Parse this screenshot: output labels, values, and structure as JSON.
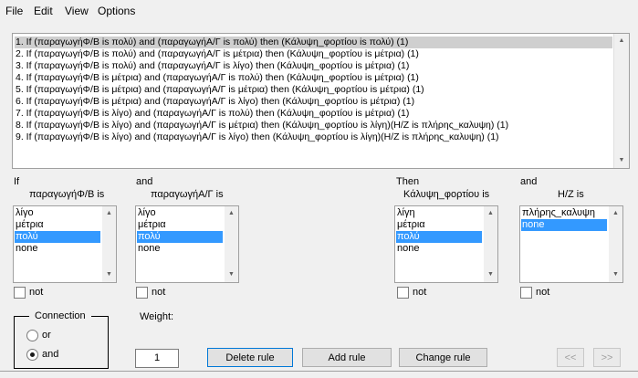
{
  "menu": [
    "File",
    "Edit",
    "View",
    "Options"
  ],
  "rules": [
    "1. If (παραγωγήΦ/Β is πολύ) and (παραγωγήΑ/Γ is πολύ) then (Κάλυψη_φορτίου is πολύ) (1)",
    "2. If (παραγωγήΦ/Β is πολύ) and (παραγωγήΑ/Γ is μέτρια) then (Κάλυψη_φορτίου is μέτρια) (1)",
    "3. If (παραγωγήΦ/Β is πολύ) and (παραγωγήΑ/Γ is λίγο) then (Κάλυψη_φορτίου is μέτρια) (1)",
    "4. If (παραγωγήΦ/Β is μέτρια) and (παραγωγήΑ/Γ is πολύ) then (Κάλυψη_φορτίου is μέτρια) (1)",
    "5. If (παραγωγήΦ/Β is μέτρια) and (παραγωγήΑ/Γ is μέτρια) then (Κάλυψη_φορτίου is μέτρια) (1)",
    "6. If (παραγωγήΦ/Β is μέτρια) and (παραγωγήΑ/Γ is λίγο) then (Κάλυψη_φορτίου is μέτρια) (1)",
    "7. If (παραγωγήΦ/Β is λίγο) and (παραγωγήΑ/Γ is πολύ) then (Κάλυψη_φορτίου is μέτρια) (1)",
    "8. If (παραγωγήΦ/Β is λίγο) and (παραγωγήΑ/Γ is μέτρια) then (Κάλυψη_φορτίου is λίγη)(Η/Ζ is πλήρης_καλυψη) (1)",
    "9. If (παραγωγήΦ/Β is λίγο) and (παραγωγήΑ/Γ is λίγο) then (Κάλυψη_φορτίου is λίγη)(Η/Ζ is πλήρης_καλυψη) (1)"
  ],
  "selected_rule_index": 0,
  "columns": {
    "input1": {
      "prefix": "If",
      "var_label": "παραγωγήΦ/Β is",
      "items": [
        "λίγο",
        "μέτρια",
        "πολύ",
        "none"
      ],
      "selected": 2,
      "not_label": "not"
    },
    "input2": {
      "prefix": "and",
      "var_label": "παραγωγήΑ/Γ is",
      "items": [
        "λίγο",
        "μέτρια",
        "πολύ",
        "none"
      ],
      "selected": 2,
      "not_label": "not"
    },
    "output1": {
      "prefix": "Then",
      "var_label": "Κάλυψη_φορτίου is",
      "items": [
        "λίγη",
        "μέτρια",
        "πολύ",
        "none"
      ],
      "selected": 2,
      "not_label": "not"
    },
    "output2": {
      "prefix": "and",
      "var_label": "Η/Ζ is",
      "items": [
        "πλήρης_καλυψη",
        "none"
      ],
      "selected": 1,
      "not_label": "not"
    }
  },
  "connection": {
    "title": "Connection",
    "options": [
      "or",
      "and"
    ],
    "selected": "and"
  },
  "weight": {
    "label": "Weight:",
    "value": "1"
  },
  "buttons": {
    "delete": "Delete rule",
    "add": "Add rule",
    "change": "Change rule",
    "prev": "<<",
    "next": ">>"
  }
}
